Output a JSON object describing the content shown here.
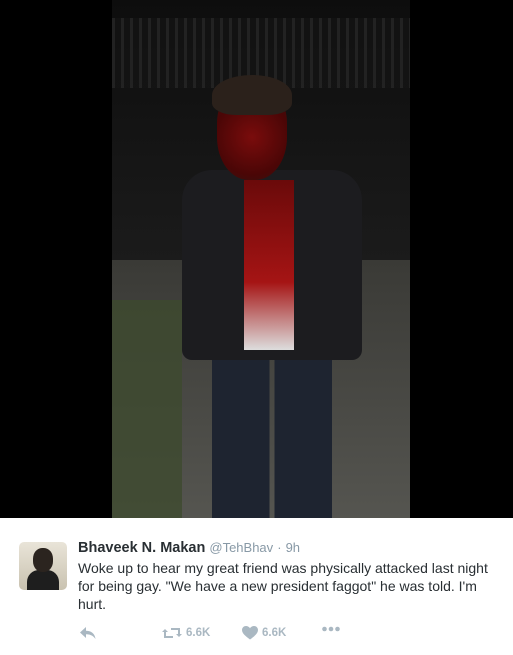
{
  "tweet": {
    "name": "Bhaveek N. Makan",
    "handle": "@TehBhav",
    "separator": "·",
    "time": "9h",
    "text": "Woke up to hear my great friend was physically attacked last night for being gay.  \"We have a new president faggot\" he was told. I'm hurt.",
    "retweet_count": "6.6K",
    "like_count": "6.6K"
  },
  "icons": {
    "reply": "reply-icon",
    "retweet": "retweet-icon",
    "like": "heart-icon",
    "more": "more-icon"
  },
  "colors": {
    "text": "#292f33",
    "muted": "#8899a6",
    "action": "#aab8c2"
  }
}
